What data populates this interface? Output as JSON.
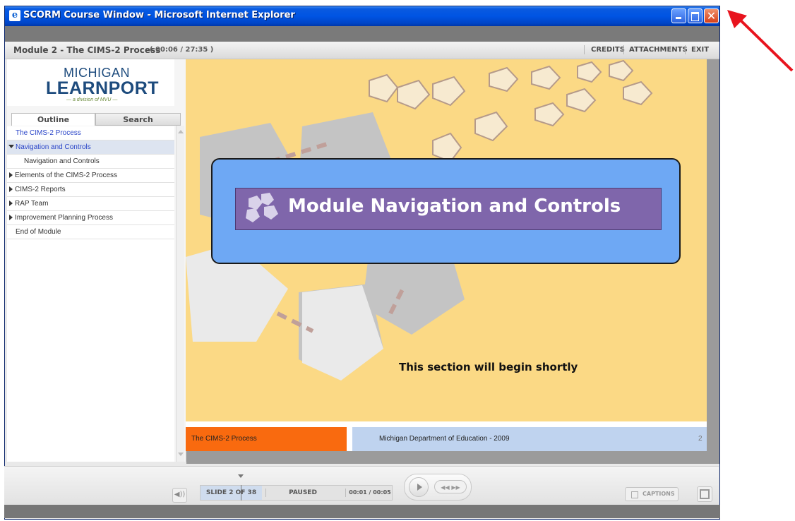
{
  "window": {
    "title": "SCORM Course Window - Microsoft Internet Explorer",
    "close_glyph": "✕"
  },
  "header": {
    "module_title": "Module 2 - The CIMS-2 Process",
    "time": "( 00:06 / 27:35 )",
    "links": {
      "credits": "CREDITS",
      "attachments": "ATTACHMENTS",
      "exit": "EXIT"
    }
  },
  "logo": {
    "line1": "MICHIGAN",
    "line2": "LEARNPORT",
    "tagline": "— a division of MVU —"
  },
  "sidebar": {
    "tabs": {
      "outline": "Outline",
      "search": "Search"
    },
    "items": [
      {
        "label": "The CIMS-2 Process"
      },
      {
        "label": "Navigation and Controls"
      },
      {
        "label": "Navigation and Controls"
      },
      {
        "label": "Elements of the CIMS-2 Process"
      },
      {
        "label": "CIMS-2 Reports"
      },
      {
        "label": "RAP Team"
      },
      {
        "label": "Improvement Planning Process"
      },
      {
        "label": "End of Module"
      }
    ]
  },
  "slide": {
    "title": "Module Navigation and Controls",
    "subtitle": "This section will begin shortly",
    "footer_left": "The CIMS-2 Process",
    "footer_center": "Michigan Department of Education - 2009",
    "page_number": "2",
    "colors": {
      "background": "#fbd985",
      "title_box": "#6ea8f4",
      "title_bar": "#7f66ab",
      "footer_orange": "#f96a0f",
      "footer_blue": "#bfd3ef"
    }
  },
  "controls": {
    "slide_count": "SLIDE 2 OF 38",
    "status": "PAUSED",
    "time": "00:01 / 00:05",
    "volume_glyph": "◀))",
    "seek_glyph": "◀◀ ▶▶",
    "captions": "CAPTIONS"
  },
  "icons": [
    "ie-icon",
    "minimize-icon",
    "maximize-icon",
    "close-icon",
    "volume-icon",
    "play-icon",
    "captions-icon",
    "fullscreen-icon"
  ]
}
